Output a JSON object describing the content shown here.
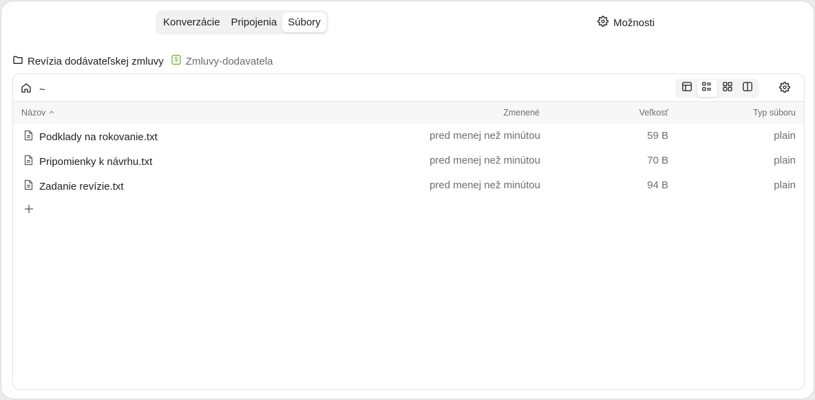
{
  "tabs": [
    {
      "label": "Konverzácie",
      "active": false
    },
    {
      "label": "Pripojenia",
      "active": false
    },
    {
      "label": "Súbory",
      "active": true
    }
  ],
  "options_label": "Možnosti",
  "breadcrumb": {
    "project": "Revízia dodávateľskej zmluvy",
    "folder": "Zmluvy-dodavatela",
    "folder_icon_color": "#7cb342"
  },
  "toolbar": {
    "path": "~"
  },
  "table": {
    "headers": {
      "name": "Názov",
      "modified": "Zmenené",
      "size": "Veľkosť",
      "type": "Typ súboru"
    },
    "rows": [
      {
        "name": "Podklady na rokovanie.txt",
        "modified": "pred menej než minútou",
        "size": "59 B",
        "type": "plain"
      },
      {
        "name": "Pripomienky k návrhu.txt",
        "modified": "pred menej než minútou",
        "size": "70 B",
        "type": "plain"
      },
      {
        "name": "Zadanie revízie.txt",
        "modified": "pred menej než minútou",
        "size": "94 B",
        "type": "plain"
      }
    ]
  },
  "icons": {
    "options": "gear-icon",
    "project": "folder-icon",
    "folder": "spreadsheet-badge-icon",
    "home": "home-icon",
    "view_table": "table-view-icon",
    "view_list": "list-view-icon",
    "view_grid": "grid-view-icon",
    "view_split": "split-view-icon",
    "settings": "gear-icon",
    "file": "text-file-icon",
    "add": "plus-icon"
  }
}
